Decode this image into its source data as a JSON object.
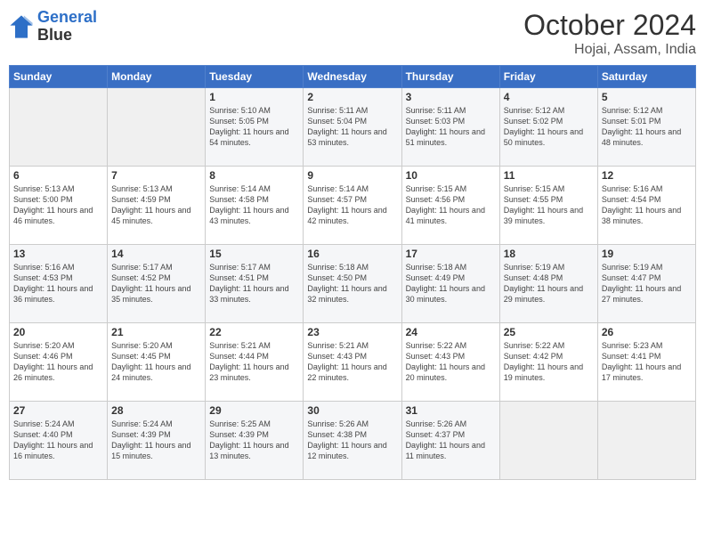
{
  "header": {
    "logo_line1": "General",
    "logo_line2": "Blue",
    "month": "October 2024",
    "location": "Hojai, Assam, India"
  },
  "days_of_week": [
    "Sunday",
    "Monday",
    "Tuesday",
    "Wednesday",
    "Thursday",
    "Friday",
    "Saturday"
  ],
  "weeks": [
    [
      {
        "day": "",
        "empty": true
      },
      {
        "day": "",
        "empty": true
      },
      {
        "day": "1",
        "sunrise": "5:10 AM",
        "sunset": "5:05 PM",
        "daylight": "11 hours and 54 minutes."
      },
      {
        "day": "2",
        "sunrise": "5:11 AM",
        "sunset": "5:04 PM",
        "daylight": "11 hours and 53 minutes."
      },
      {
        "day": "3",
        "sunrise": "5:11 AM",
        "sunset": "5:03 PM",
        "daylight": "11 hours and 51 minutes."
      },
      {
        "day": "4",
        "sunrise": "5:12 AM",
        "sunset": "5:02 PM",
        "daylight": "11 hours and 50 minutes."
      },
      {
        "day": "5",
        "sunrise": "5:12 AM",
        "sunset": "5:01 PM",
        "daylight": "11 hours and 48 minutes."
      }
    ],
    [
      {
        "day": "6",
        "sunrise": "5:13 AM",
        "sunset": "5:00 PM",
        "daylight": "11 hours and 46 minutes."
      },
      {
        "day": "7",
        "sunrise": "5:13 AM",
        "sunset": "4:59 PM",
        "daylight": "11 hours and 45 minutes."
      },
      {
        "day": "8",
        "sunrise": "5:14 AM",
        "sunset": "4:58 PM",
        "daylight": "11 hours and 43 minutes."
      },
      {
        "day": "9",
        "sunrise": "5:14 AM",
        "sunset": "4:57 PM",
        "daylight": "11 hours and 42 minutes."
      },
      {
        "day": "10",
        "sunrise": "5:15 AM",
        "sunset": "4:56 PM",
        "daylight": "11 hours and 41 minutes."
      },
      {
        "day": "11",
        "sunrise": "5:15 AM",
        "sunset": "4:55 PM",
        "daylight": "11 hours and 39 minutes."
      },
      {
        "day": "12",
        "sunrise": "5:16 AM",
        "sunset": "4:54 PM",
        "daylight": "11 hours and 38 minutes."
      }
    ],
    [
      {
        "day": "13",
        "sunrise": "5:16 AM",
        "sunset": "4:53 PM",
        "daylight": "11 hours and 36 minutes."
      },
      {
        "day": "14",
        "sunrise": "5:17 AM",
        "sunset": "4:52 PM",
        "daylight": "11 hours and 35 minutes."
      },
      {
        "day": "15",
        "sunrise": "5:17 AM",
        "sunset": "4:51 PM",
        "daylight": "11 hours and 33 minutes."
      },
      {
        "day": "16",
        "sunrise": "5:18 AM",
        "sunset": "4:50 PM",
        "daylight": "11 hours and 32 minutes."
      },
      {
        "day": "17",
        "sunrise": "5:18 AM",
        "sunset": "4:49 PM",
        "daylight": "11 hours and 30 minutes."
      },
      {
        "day": "18",
        "sunrise": "5:19 AM",
        "sunset": "4:48 PM",
        "daylight": "11 hours and 29 minutes."
      },
      {
        "day": "19",
        "sunrise": "5:19 AM",
        "sunset": "4:47 PM",
        "daylight": "11 hours and 27 minutes."
      }
    ],
    [
      {
        "day": "20",
        "sunrise": "5:20 AM",
        "sunset": "4:46 PM",
        "daylight": "11 hours and 26 minutes."
      },
      {
        "day": "21",
        "sunrise": "5:20 AM",
        "sunset": "4:45 PM",
        "daylight": "11 hours and 24 minutes."
      },
      {
        "day": "22",
        "sunrise": "5:21 AM",
        "sunset": "4:44 PM",
        "daylight": "11 hours and 23 minutes."
      },
      {
        "day": "23",
        "sunrise": "5:21 AM",
        "sunset": "4:43 PM",
        "daylight": "11 hours and 22 minutes."
      },
      {
        "day": "24",
        "sunrise": "5:22 AM",
        "sunset": "4:43 PM",
        "daylight": "11 hours and 20 minutes."
      },
      {
        "day": "25",
        "sunrise": "5:22 AM",
        "sunset": "4:42 PM",
        "daylight": "11 hours and 19 minutes."
      },
      {
        "day": "26",
        "sunrise": "5:23 AM",
        "sunset": "4:41 PM",
        "daylight": "11 hours and 17 minutes."
      }
    ],
    [
      {
        "day": "27",
        "sunrise": "5:24 AM",
        "sunset": "4:40 PM",
        "daylight": "11 hours and 16 minutes."
      },
      {
        "day": "28",
        "sunrise": "5:24 AM",
        "sunset": "4:39 PM",
        "daylight": "11 hours and 15 minutes."
      },
      {
        "day": "29",
        "sunrise": "5:25 AM",
        "sunset": "4:39 PM",
        "daylight": "11 hours and 13 minutes."
      },
      {
        "day": "30",
        "sunrise": "5:26 AM",
        "sunset": "4:38 PM",
        "daylight": "11 hours and 12 minutes."
      },
      {
        "day": "31",
        "sunrise": "5:26 AM",
        "sunset": "4:37 PM",
        "daylight": "11 hours and 11 minutes."
      },
      {
        "day": "",
        "empty": true
      },
      {
        "day": "",
        "empty": true
      }
    ]
  ]
}
